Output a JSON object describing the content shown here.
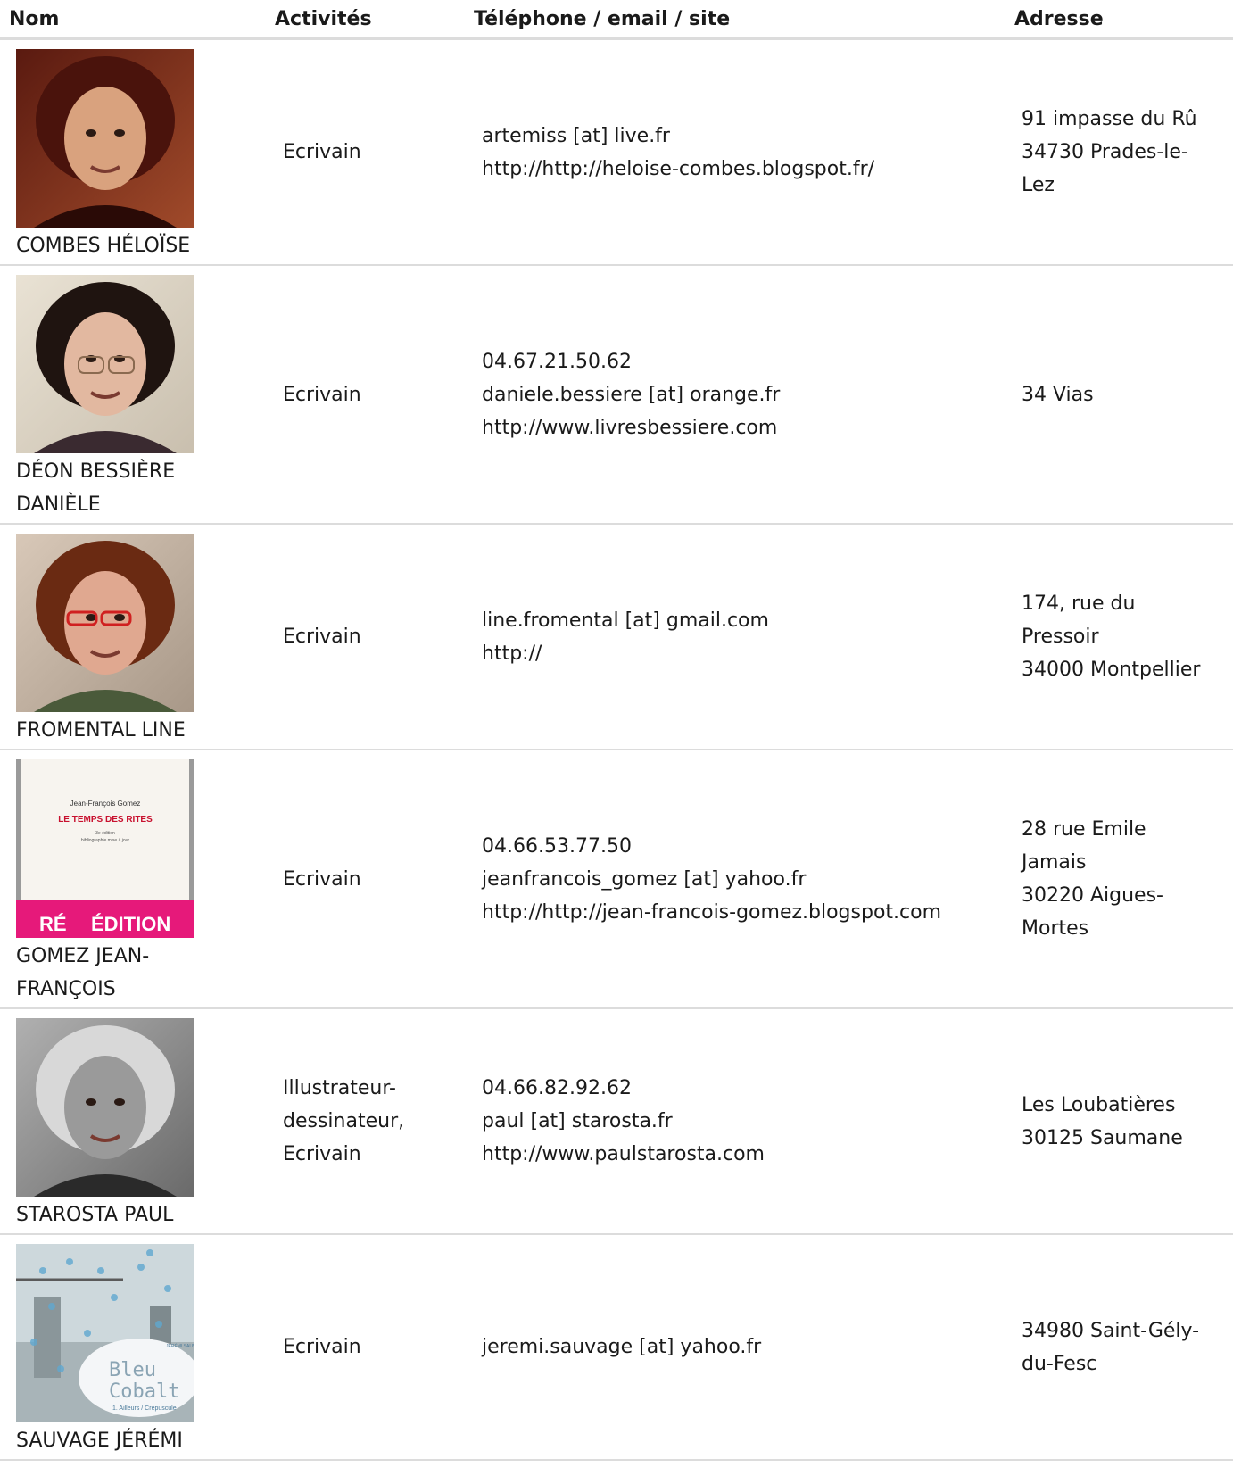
{
  "header": {
    "nom": "Nom",
    "activites": "Activités",
    "contact": "Téléphone / email / site",
    "adresse": "Adresse"
  },
  "rows": [
    {
      "name": "COMBES HÉLOÏSE",
      "activities": [
        "Ecrivain"
      ],
      "contact": [
        "artemiss [at] live.fr",
        "http://http://heloise-combes.blogspot.fr/"
      ],
      "address": [
        "91 impasse du Rû",
        "34730 Prades-le-",
        "Lez"
      ],
      "photo_icon": "portrait-woman-dark-curly-hair"
    },
    {
      "name": "DÉON BESSIÈRE DANIÈLE",
      "activities": [
        "Ecrivain"
      ],
      "contact": [
        "04.67.21.50.62",
        "daniele.bessiere [at] orange.fr",
        "http://www.livresbessiere.com"
      ],
      "address": [
        "34 Vias"
      ],
      "photo_icon": "portrait-woman-curly-hair-glasses"
    },
    {
      "name": "FROMENTAL LINE",
      "activities": [
        "Ecrivain"
      ],
      "contact": [
        "line.fromental [at] gmail.com",
        "http://"
      ],
      "address": [
        "174, rue du",
        "Pressoir",
        "34000 Montpellier"
      ],
      "photo_icon": "portrait-woman-red-glasses"
    },
    {
      "name": "GOMEZ JEAN-FRANÇOIS",
      "activities": [
        "Ecrivain"
      ],
      "contact": [
        "04.66.53.77.50",
        "jeanfrancois_gomez [at] yahoo.fr",
        "http://http://jean-francois-gomez.blogspot.com"
      ],
      "address": [
        "28 rue Emile",
        "Jamais",
        "30220 Aigues-",
        "Mortes"
      ],
      "photo_icon": "book-cover",
      "cover": {
        "author": "Jean-François Gomez",
        "title": "LE TEMPS DES RITES",
        "subtitle1": "3e édition",
        "subtitle2": "bibliographie mise à jour",
        "band_left": "RÉ",
        "band_right": "ÉDITION",
        "band_color": "#e6197a"
      }
    },
    {
      "name": "STAROSTA PAUL",
      "activities": [
        "Illustrateur-",
        "dessinateur,",
        "Ecrivain"
      ],
      "contact": [
        "04.66.82.92.62",
        "paul [at] starosta.fr",
        "http://www.paulstarosta.com"
      ],
      "address": [
        "Les Loubatières",
        "30125 Saumane"
      ],
      "photo_icon": "portrait-man-black-and-white"
    },
    {
      "name": "SAUVAGE JÉRÉMI",
      "activities": [
        "Ecrivain"
      ],
      "contact": [
        "jeremi.sauvage [at] yahoo.fr"
      ],
      "address": [
        "34980 Saint-Gély-",
        "du-Fesc"
      ],
      "photo_icon": "book-cover-illustrated",
      "cover": {
        "title1": "Bleu",
        "title2": "Cobalt",
        "subtitle": "1. Ailleurs / Crépuscule",
        "author": "JÉRÉMI SAUVAGE"
      }
    }
  ]
}
